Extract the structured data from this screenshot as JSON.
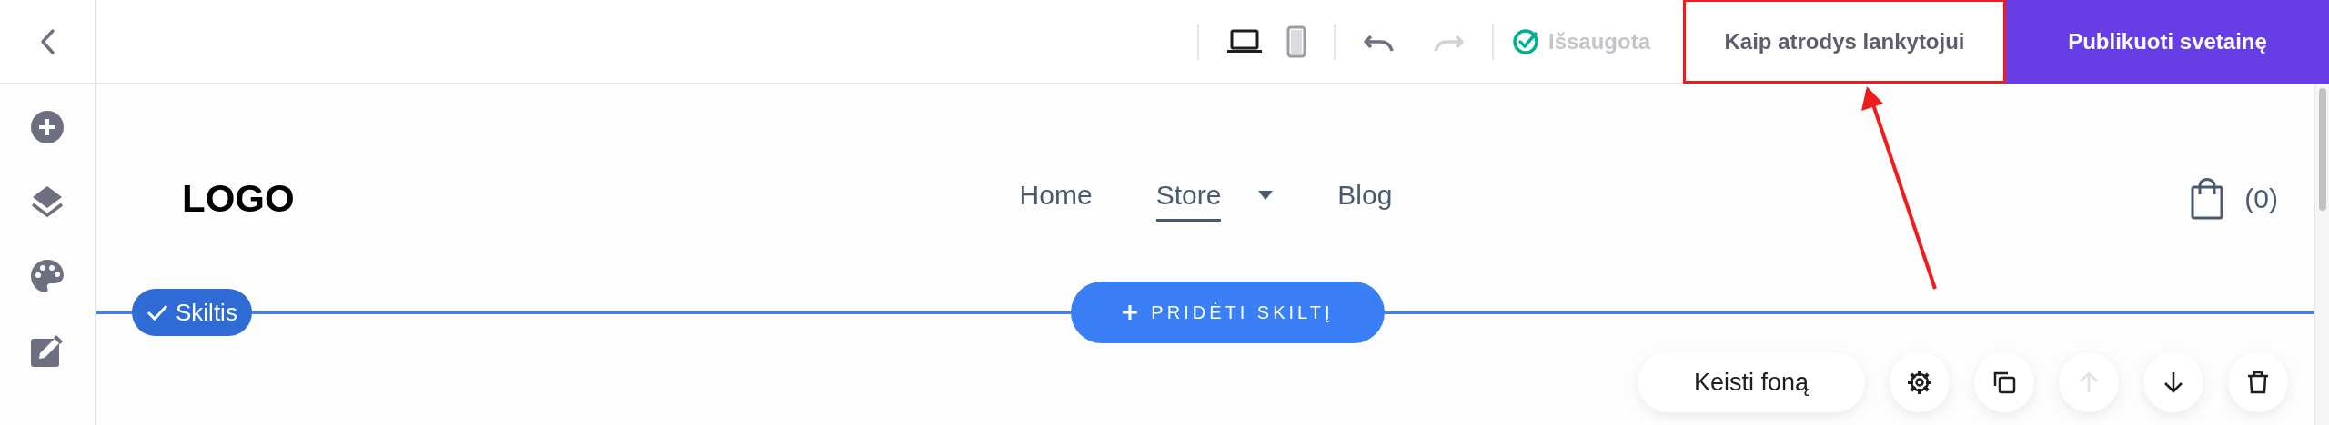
{
  "top_bar": {
    "devices": [
      {
        "kind": "desktop",
        "selected": true
      },
      {
        "kind": "mobile",
        "selected": false
      }
    ],
    "history": [
      {
        "kind": "undo",
        "disabled": false
      },
      {
        "kind": "redo",
        "disabled": true
      }
    ],
    "save_status": "Išsaugota",
    "preview_button": {
      "label": "Kaip atrodys lankytojui",
      "highlighted": true
    },
    "publish_button": "Publikuoti svetainę"
  },
  "sidebar": {
    "items": [
      {
        "kind": "add"
      },
      {
        "kind": "layers"
      },
      {
        "kind": "palette"
      },
      {
        "kind": "edit"
      }
    ]
  },
  "site_header": {
    "logo": "LOGO",
    "nav": [
      {
        "label": "Home",
        "selected": false,
        "dropdown": false
      },
      {
        "label": "Store",
        "selected": true,
        "dropdown": true
      },
      {
        "label": "Blog",
        "selected": false,
        "dropdown": false
      }
    ],
    "cart_count": "(0)"
  },
  "section": {
    "badge": "Skiltis",
    "add_button": "PRIDĖTI SKILTĮ"
  },
  "section_toolbar": {
    "background_button": "Keisti foną",
    "actions": [
      {
        "kind": "settings",
        "disabled": false
      },
      {
        "kind": "duplicate",
        "disabled": false
      },
      {
        "kind": "move_up",
        "disabled": true
      },
      {
        "kind": "move_down",
        "disabled": false
      },
      {
        "kind": "delete",
        "disabled": false
      }
    ]
  }
}
